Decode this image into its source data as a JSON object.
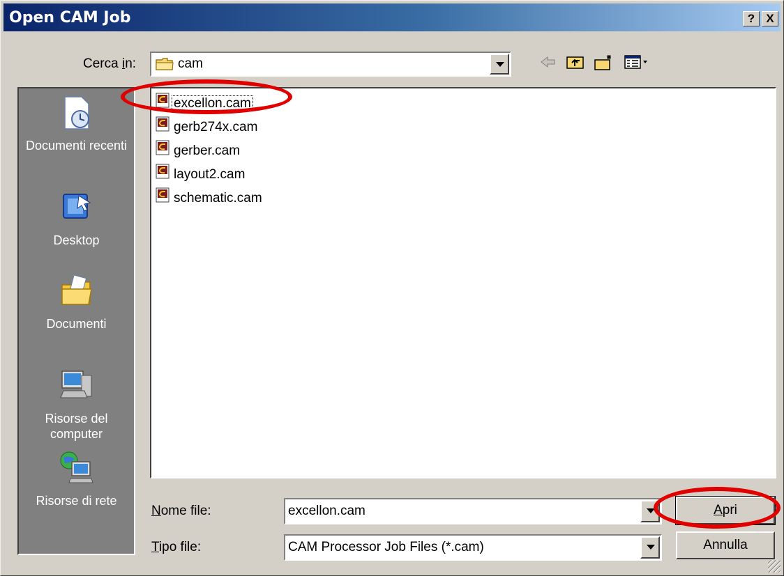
{
  "window": {
    "title": "Open CAM Job",
    "help_label": "?",
    "close_label": "X"
  },
  "lookin": {
    "label_prefix": "Cerca ",
    "label_accel": "i",
    "label_suffix": "n:",
    "value": "cam",
    "folder_icon": "folder-icon"
  },
  "toolbar": {
    "back_icon": "back-arrow-icon",
    "up_icon": "folder-up-icon",
    "new_folder_icon": "new-folder-icon",
    "view_icon": "view-menu-icon"
  },
  "places": [
    {
      "label": "Documenti recenti",
      "icon": "recent-documents-icon"
    },
    {
      "label": "Desktop",
      "icon": "desktop-icon"
    },
    {
      "label": "Documenti",
      "icon": "my-documents-icon"
    },
    {
      "label": "Risorse del computer",
      "icon": "my-computer-icon"
    },
    {
      "label": "Risorse di rete",
      "icon": "network-icon"
    }
  ],
  "files": [
    {
      "name": "excellon.cam",
      "selected": true
    },
    {
      "name": "gerb274x.cam",
      "selected": false
    },
    {
      "name": "gerber.cam",
      "selected": false
    },
    {
      "name": "layout2.cam",
      "selected": false
    },
    {
      "name": "schematic.cam",
      "selected": false
    }
  ],
  "filename": {
    "label_accel": "N",
    "label_rest": "ome file:",
    "value": "excellon.cam"
  },
  "filetype": {
    "label_accel": "T",
    "label_rest": "ipo file:",
    "value": "CAM Processor Job Files (*.cam)"
  },
  "buttons": {
    "open_accel": "A",
    "open_rest": "pri",
    "cancel": "Annulla"
  },
  "colors": {
    "annotation": "#e00000",
    "title_bar": "#0a246a",
    "dialog_face": "#d4d0c8"
  }
}
